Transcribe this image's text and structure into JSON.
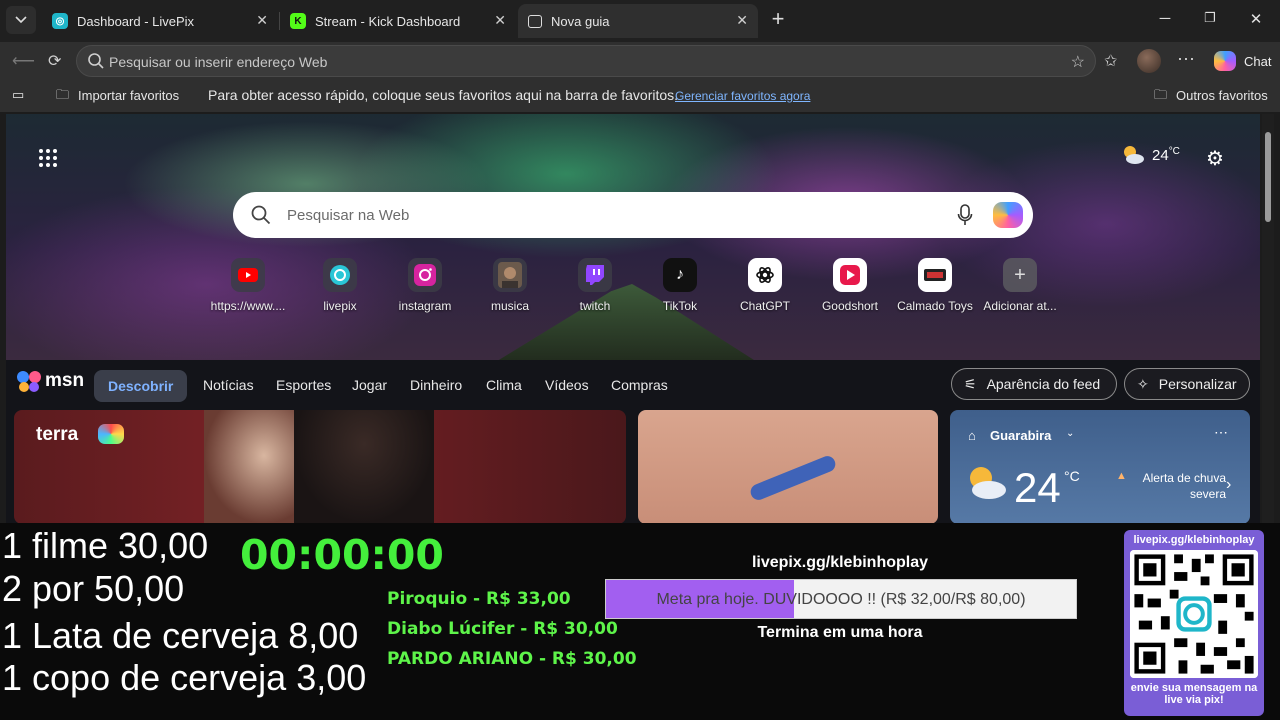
{
  "browser": {
    "tabs": [
      {
        "title": "Dashboard - LivePix",
        "favicon": "livepix-icon"
      },
      {
        "title": "Stream - Kick Dashboard",
        "favicon": "kick-icon"
      },
      {
        "title": "Nova guia",
        "favicon": "newtab-icon"
      }
    ],
    "address_placeholder": "Pesquisar ou inserir endereço Web",
    "chat_label": "Chat",
    "favorites_bar": {
      "import_label": "Importar favoritos",
      "hint": "Para obter acesso rápido, coloque seus favoritos aqui na barra de favoritos.",
      "manage_link": "Gerenciar favoritos agora",
      "other_label": "Outros favoritos"
    }
  },
  "newtab": {
    "weather_temp": "24",
    "weather_unit": "°C",
    "search_placeholder": "Pesquisar na Web",
    "shortcuts": [
      {
        "label": "https://www....",
        "icon": "youtube-icon"
      },
      {
        "label": "livepix",
        "icon": "livepix-icon"
      },
      {
        "label": "instagram",
        "icon": "instagram-icon"
      },
      {
        "label": "musica",
        "icon": "music-avatar-icon"
      },
      {
        "label": "twitch",
        "icon": "twitch-icon"
      },
      {
        "label": "TikTok",
        "icon": "tiktok-icon"
      },
      {
        "label": "ChatGPT",
        "icon": "chatgpt-icon"
      },
      {
        "label": "Goodshort",
        "icon": "goodshort-icon"
      },
      {
        "label": "Calmado Toys",
        "icon": "calmado-icon"
      },
      {
        "label": "Adicionar at...",
        "icon": "plus-icon"
      }
    ],
    "msn": {
      "logo": "msn",
      "nav": [
        "Descobrir",
        "Notícias",
        "Esportes",
        "Jogar",
        "Dinheiro",
        "Clima",
        "Vídeos",
        "Compras"
      ],
      "appearance_btn": "Aparência do feed",
      "personalize_btn": "Personalizar",
      "card1_source": "terra",
      "weather_card": {
        "city": "Guarabira",
        "temp": "24",
        "unit": "°C",
        "alert": "Alerta de chuva severa"
      }
    }
  },
  "overlay": {
    "menu": [
      "1 filme 30,00",
      "2 por 50,00",
      "1 Lata de cerveja 8,00",
      "1 copo de cerveja 3,00"
    ],
    "timer": "00:00:00",
    "donors": [
      "Piroquio - R$ 33,00",
      "Diabo Lúcifer - R$ 30,00",
      "PARDO ARIANO - R$ 30,00"
    ],
    "goal": {
      "url": "livepix.gg/klebinhoplay",
      "text": "Meta pra hoje. DUVIDOOOO !! (R$ 32,00/R$ 80,00)",
      "current": 32,
      "target": 80,
      "ends": "Termina em uma hora"
    },
    "qr": {
      "header": "livepix.gg/klebinhoplay",
      "footer": "envie sua mensagem na live via pix!"
    }
  }
}
